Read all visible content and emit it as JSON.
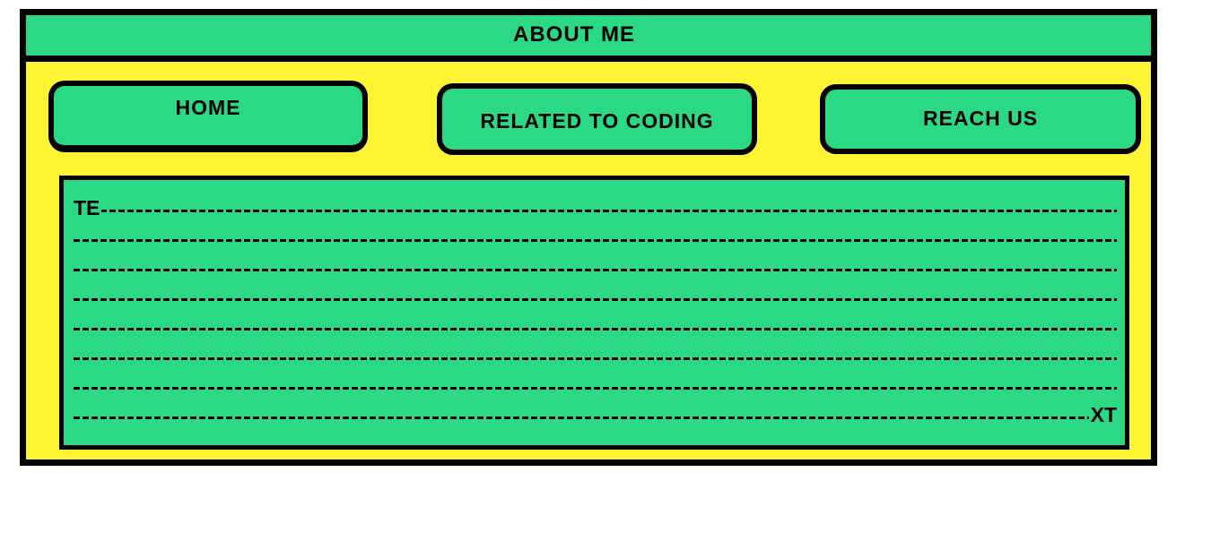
{
  "header": {
    "title": "ABOUT ME"
  },
  "nav": {
    "home_label": "HOME",
    "coding_label": "RELATED TO CODING",
    "reach_label": "REACH US"
  },
  "content": {
    "text_start": "TE",
    "text_end": "XT",
    "line_count": 8
  },
  "colors": {
    "page_background": "#fef433",
    "panel_green": "#2bd985",
    "border": "#000000",
    "outside": "#ffffff"
  }
}
